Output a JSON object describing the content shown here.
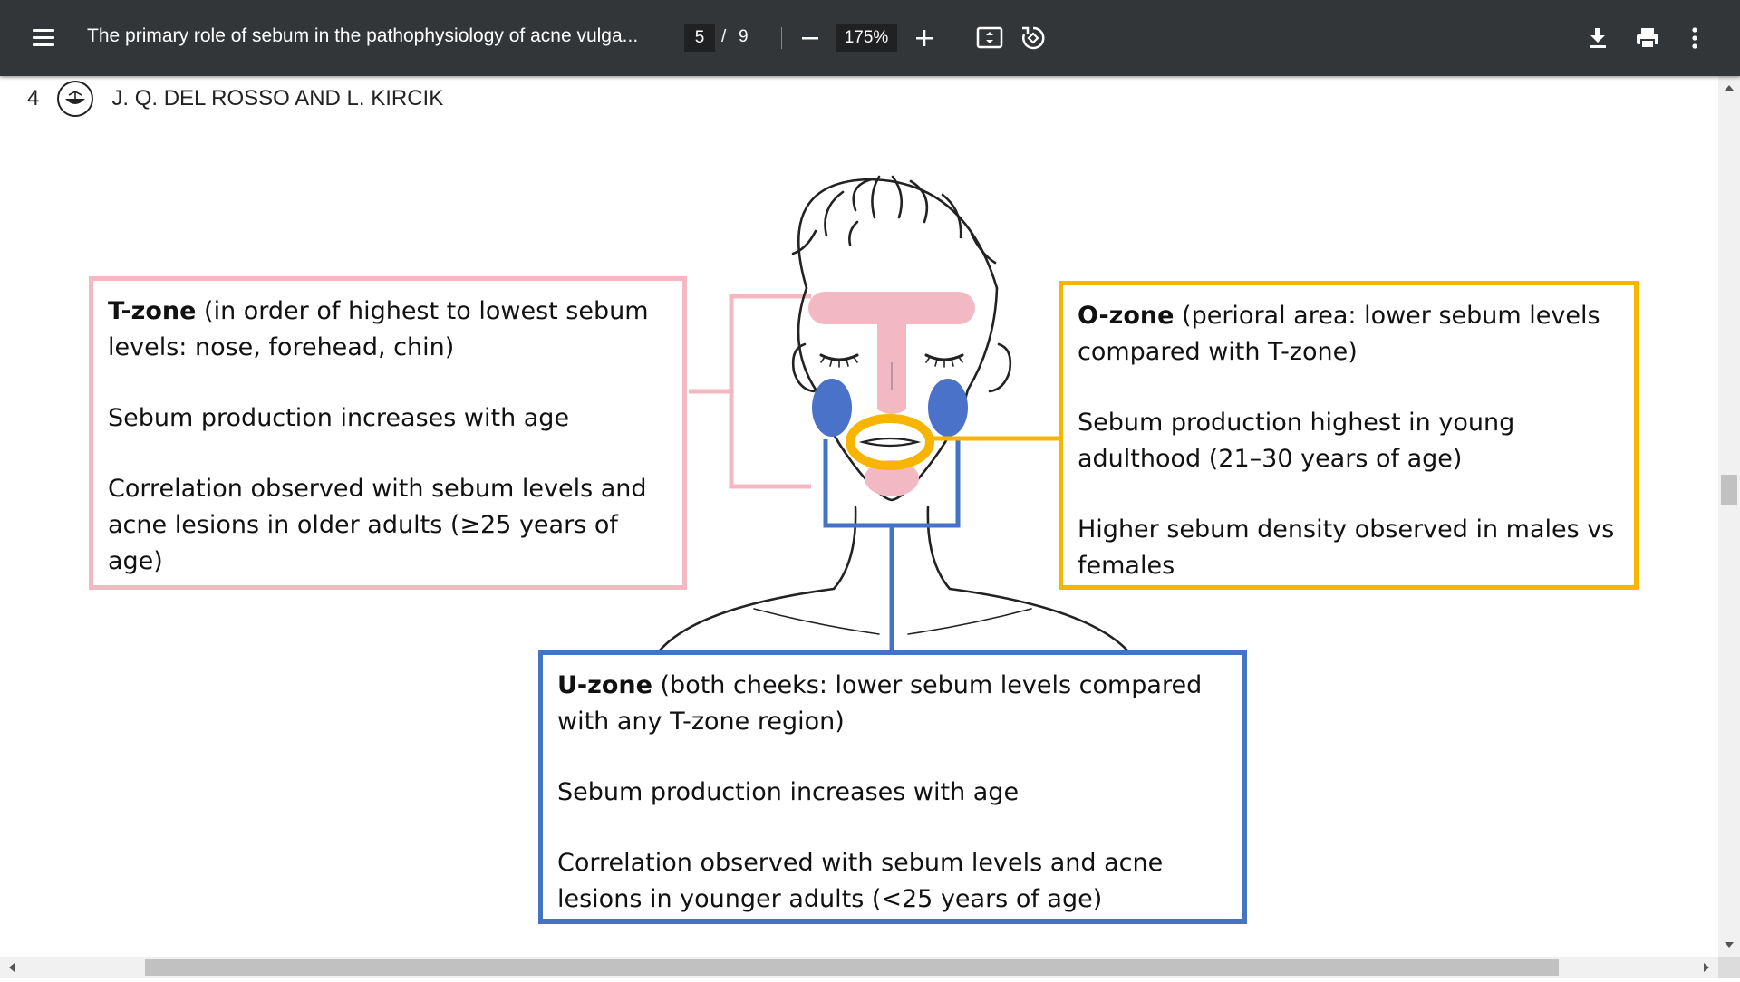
{
  "toolbar": {
    "title": "The primary role of sebum in the pathophysiology of acne vulga...",
    "page_current": "5",
    "page_separator": "/",
    "page_total": "9",
    "zoom": "175%",
    "icons": [
      "menu-icon",
      "zoom-out-icon",
      "zoom-in-icon",
      "fit-page-icon",
      "rotate-icon",
      "download-icon",
      "print-icon",
      "more-icon"
    ]
  },
  "page": {
    "page_number": "4",
    "authors": "J. Q. DEL ROSSO AND L. KIRCIK"
  },
  "figure": {
    "tzone": {
      "title": "T-zone",
      "title_rest": " (in order of highest to lowest sebum levels: nose, forehead, chin)",
      "line2": "Sebum production increases with age",
      "line3": "Correlation observed with sebum levels and acne lesions in older adults (≥25 years of age)",
      "color": "#f4b8c2"
    },
    "ozone": {
      "title": "O-zone",
      "title_rest": " (perioral area: lower sebum levels compared with T-zone)",
      "line2": "Sebum production highest in young adulthood (21–30 years of age)",
      "line3": "Higher sebum density observed in males vs females",
      "color": "#f7b500"
    },
    "uzone": {
      "title": "U-zone",
      "title_rest": " (both cheeks: lower sebum levels compared with any T-zone region)",
      "line2": "Sebum production increases with age",
      "line3": "Correlation observed with sebum levels and acne lesions in younger adults (<25 years of age)",
      "color": "#4472c4"
    },
    "face_pink": "#f2b8c4",
    "cheek_blue": "#4a72c8"
  }
}
